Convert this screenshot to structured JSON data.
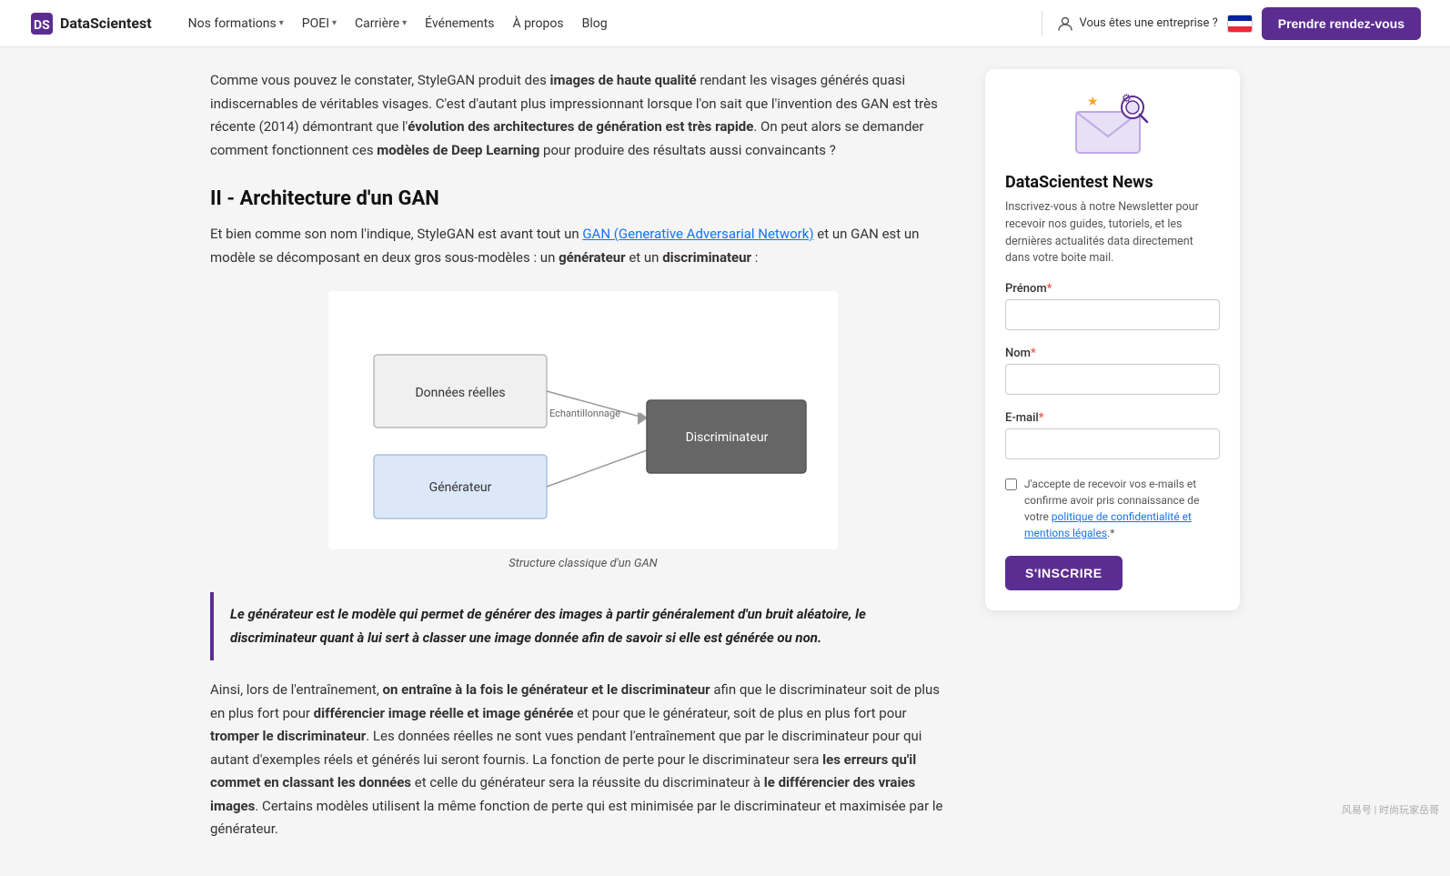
{
  "nav": {
    "logo_text": "DataScientest",
    "links": [
      {
        "label": "Nos formations",
        "has_dropdown": true
      },
      {
        "label": "POEI",
        "has_dropdown": true
      },
      {
        "label": "Carrière",
        "has_dropdown": true
      },
      {
        "label": "Événements",
        "has_dropdown": false
      },
      {
        "label": "À propos",
        "has_dropdown": false
      },
      {
        "label": "Blog",
        "has_dropdown": false
      }
    ],
    "enterprise_label": "Vous êtes une entreprise ?",
    "cta_label": "Prendre rendez-vous"
  },
  "article": {
    "intro_p1": "Comme vous pouvez le constater, StyleGAN produit des ",
    "intro_bold1": "images de haute qualité",
    "intro_p1b": " rendant les visages générés quasi indiscernables de véritables visages. C'est d'autant plus impressionnant lorsque l'on sait que l'invention des GAN est très récente (2014) démontrant que l'",
    "intro_bold2": "évolution des architectures de génération est très rapide",
    "intro_p1c": ". On peut alors se demander comment fonctionnent ces ",
    "intro_bold3": "modèles de Deep Learning",
    "intro_p1d": " pour produire des résultats aussi convaincants ?",
    "h2": "II - Architecture d'un GAN",
    "p2_prefix": "Et bien comme son nom l'indique, StyleGAN est avant tout un ",
    "p2_link": "GAN (Generative Adversarial Network)",
    "p2_suffix": " et un GAN est un modèle se décomposant en deux gros sous-modèles : un ",
    "p2_bold1": "générateur",
    "p2_mid": " et un ",
    "p2_bold2": "discriminateur",
    "p2_end": " :",
    "diagram": {
      "caption": "Structure classique d'un GAN",
      "node_donnees": "Données réelles",
      "node_generateur": "Générateur",
      "node_discriminateur": "Discriminateur",
      "edge_label": "Echantillonnage"
    },
    "blockquote": "Le générateur est le modèle qui permet de générer des images à partir généralement d'un bruit aléatoire, le discriminateur quant à lui sert à classer une image donnée afin de savoir si elle est générée ou non.",
    "p3_prefix": "Ainsi, lors de l'entraînement, ",
    "p3_bold1": "on entraîne à la fois le générateur et le discriminateur",
    "p3_mid1": " afin que le discriminateur soit de plus en plus fort pour ",
    "p3_bold2": "différencier image réelle et image générée",
    "p3_mid2": " et pour que le générateur, soit de plus en plus fort pour ",
    "p3_bold3": "tromper le discriminateur",
    "p3_mid3": ". Les données réelles ne sont vues pendant l'entraînement que par le discriminateur pour qui autant d'exemples réels et générés lui seront fournis. La fonction de perte pour le discriminateur sera ",
    "p3_bold4": "les erreurs qu'il commet en classant les données",
    "p3_mid4": " et celle du générateur sera la réussite du discriminateur à ",
    "p3_bold5": "le différencier des vraies images",
    "p3_end": ". Certains modèles utilisent la même fonction de perte qui est minimisée par le discriminateur et maximisée par le générateur."
  },
  "sidebar": {
    "title": "DataScientest News",
    "desc": "Inscrivez-vous à notre Newsletter pour recevoir nos guides, tutoriels, et les dernières actualités data directement dans votre boite mail.",
    "prenom_label": "Prénom",
    "nom_label": "Nom",
    "email_label": "E-mail",
    "checkbox_text": "J'accepte de recevoir vos e-mails et confirme avoir pris connaissance de votre politique de confidentialité et mentions légales.",
    "submit_label": "S'INSCRIRE"
  },
  "watermark": "风易号 | 时尚玩家岳哥"
}
